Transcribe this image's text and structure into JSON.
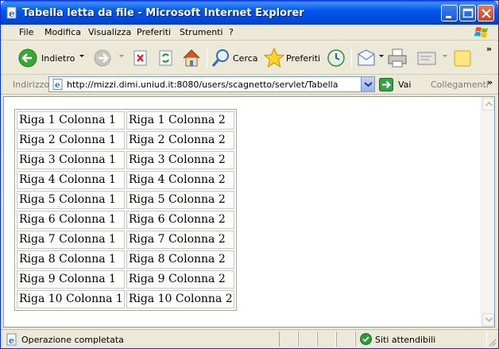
{
  "window": {
    "title": "Tabella letta da file - Microsoft Internet Explorer"
  },
  "menu": [
    "File",
    "Modifica",
    "Visualizza",
    "Preferiti",
    "Strumenti",
    "?"
  ],
  "toolbar": {
    "back": "Indietro",
    "search": "Cerca",
    "favorites": "Preferiti"
  },
  "address": {
    "label": "Indirizzo",
    "url": "http://mizzi.dimi.uniud.it:8080/users/scagnetto/servlet/Tabella",
    "go": "Vai",
    "links": "Collegamenti"
  },
  "table": {
    "rows": [
      [
        "Riga 1 Colonna 1",
        "Riga 1 Colonna 2"
      ],
      [
        "Riga 2 Colonna 1",
        "Riga 2 Colonna 2"
      ],
      [
        "Riga 3 Colonna 1",
        "Riga 3 Colonna 2"
      ],
      [
        "Riga 4 Colonna 1",
        "Riga 4 Colonna 2"
      ],
      [
        "Riga 5 Colonna 1",
        "Riga 5 Colonna 2"
      ],
      [
        "Riga 6 Colonna 1",
        "Riga 6 Colonna 2"
      ],
      [
        "Riga 7 Colonna 1",
        "Riga 7 Colonna 2"
      ],
      [
        "Riga 8 Colonna 1",
        "Riga 8 Colonna 2"
      ],
      [
        "Riga 9 Colonna 1",
        "Riga 9 Colonna 2"
      ],
      [
        "Riga 10 Colonna 1",
        "Riga 10 Colonna 2"
      ]
    ]
  },
  "status": {
    "text": "Operazione completata",
    "zone": "Siti attendibili"
  },
  "icons": {
    "title": "ie-page-icon",
    "minimize": "minimize-icon",
    "maximize": "maximize-icon",
    "close": "close-icon",
    "back": "back-arrow-icon",
    "forward": "forward-arrow-icon",
    "stop": "stop-icon",
    "refresh": "refresh-icon",
    "home": "home-icon",
    "search": "search-icon",
    "favorites": "favorites-star-icon",
    "history": "history-icon",
    "mail": "mail-icon",
    "print": "print-icon",
    "edit": "edit-icon",
    "messenger": "note-icon",
    "go": "go-arrow-icon",
    "status": "page-done-icon",
    "zone": "trusted-zone-icon"
  },
  "colors": {
    "title_bar": "#0058ee",
    "close_button": "#c84221",
    "window_face": "#ece9d8"
  }
}
